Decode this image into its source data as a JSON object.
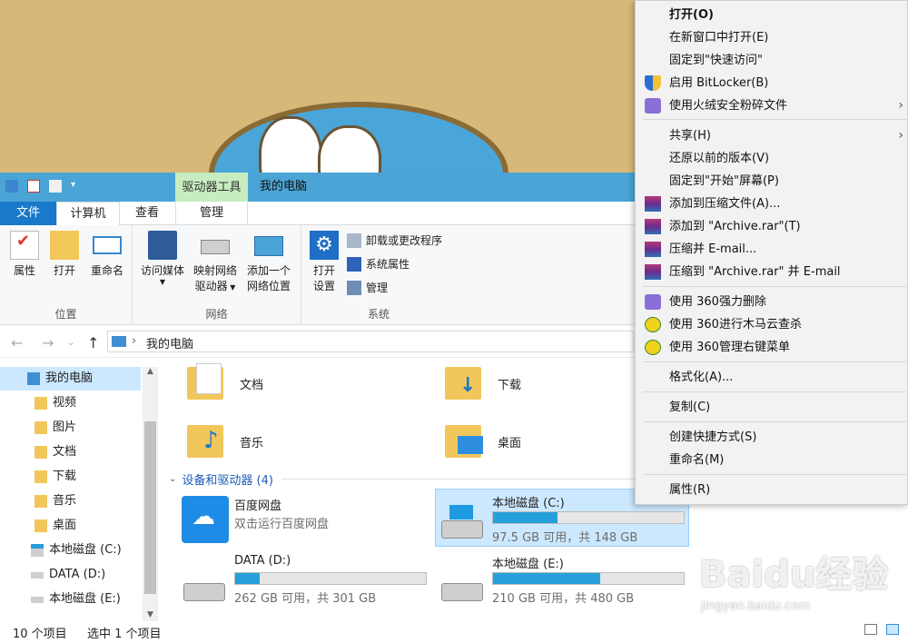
{
  "window": {
    "contextual_tab_group": "驱动器工具",
    "title": "我的电脑"
  },
  "tabs": {
    "file": "文件",
    "computer": "计算机",
    "view": "查看",
    "manage": "管理"
  },
  "ribbon": {
    "location": {
      "label": "位置",
      "properties": "属性",
      "open": "打开",
      "rename": "重命名"
    },
    "network": {
      "label": "网络",
      "access_media": "访问媒体",
      "map_drive_line1": "映射网络",
      "map_drive_line2": "驱动器",
      "add_location_line1": "添加一个",
      "add_location_line2": "网络位置"
    },
    "system": {
      "label": "系统",
      "open_settings_line1": "打开",
      "open_settings_line2": "设置",
      "uninstall": "卸载或更改程序",
      "system_properties": "系统属性",
      "manage": "管理"
    }
  },
  "address": {
    "path": "我的电脑"
  },
  "sidebar": {
    "items": [
      {
        "label": "我的电脑",
        "icon": "computer-icon"
      },
      {
        "label": "视频",
        "icon": "videos-folder-icon"
      },
      {
        "label": "图片",
        "icon": "pictures-folder-icon"
      },
      {
        "label": "文档",
        "icon": "documents-folder-icon"
      },
      {
        "label": "下载",
        "icon": "downloads-folder-icon"
      },
      {
        "label": "音乐",
        "icon": "music-folder-icon"
      },
      {
        "label": "桌面",
        "icon": "desktop-folder-icon"
      },
      {
        "label": "本地磁盘 (C:)",
        "icon": "windows-drive-icon"
      },
      {
        "label": "DATA (D:)",
        "icon": "drive-icon"
      },
      {
        "label": "本地磁盘 (E:)",
        "icon": "drive-icon"
      }
    ]
  },
  "content": {
    "folders": [
      {
        "label": "文档"
      },
      {
        "label": "下载"
      },
      {
        "label": "音乐"
      },
      {
        "label": "桌面"
      }
    ],
    "section_header": "设备和驱动器 (4)",
    "baidu": {
      "name": "百度网盘",
      "subtitle": "双击运行百度网盘"
    },
    "drives": [
      {
        "name": "本地磁盘 (C:)",
        "usage": "97.5 GB 可用，共 148 GB",
        "used_fraction": 0.34
      },
      {
        "name": "DATA (D:)",
        "usage": "262 GB 可用，共 301 GB",
        "used_fraction": 0.13
      },
      {
        "name": "本地磁盘 (E:)",
        "usage": "210 GB 可用，共 480 GB",
        "used_fraction": 0.56
      }
    ]
  },
  "status": {
    "item_count": "10 个项目",
    "selected": "选中 1 个项目"
  },
  "context_menu": {
    "items": [
      {
        "label": "打开(O)"
      },
      {
        "label": "在新窗口中打开(E)"
      },
      {
        "label": "固定到\"快速访问\""
      },
      {
        "label": "启用 BitLocker(B)"
      },
      {
        "label": "使用火绒安全粉碎文件"
      },
      {
        "label": "共享(H)"
      },
      {
        "label": "还原以前的版本(V)"
      },
      {
        "label": "固定到\"开始\"屏幕(P)"
      },
      {
        "label": "添加到压缩文件(A)..."
      },
      {
        "label": "添加到 \"Archive.rar\"(T)"
      },
      {
        "label": "压缩并 E-mail..."
      },
      {
        "label": "压缩到 \"Archive.rar\" 并 E-mail"
      },
      {
        "label": "使用 360强力删除"
      },
      {
        "label": "使用 360进行木马云查杀"
      },
      {
        "label": "使用 360管理右键菜单"
      },
      {
        "label": "格式化(A)..."
      },
      {
        "label": "复制(C)"
      },
      {
        "label": "创建快捷方式(S)"
      },
      {
        "label": "重命名(M)"
      },
      {
        "label": "属性(R)"
      }
    ]
  },
  "watermark": {
    "brand": "Baidu经验",
    "url": "jingyan.baidu.com"
  }
}
